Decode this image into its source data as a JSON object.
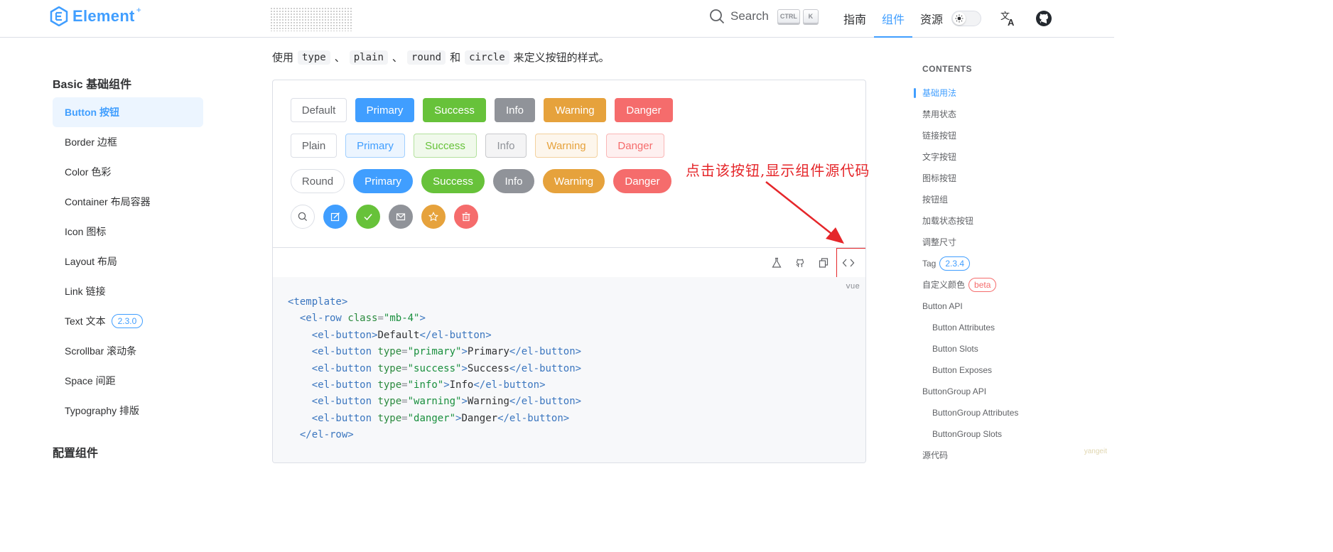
{
  "header": {
    "logo_text": "Element",
    "logo_plus": "+",
    "search_label": "Search",
    "kbd_ctrl": "CTRL",
    "kbd_k": "K",
    "nav": [
      {
        "label": "指南",
        "active": false
      },
      {
        "label": "组件",
        "active": true
      },
      {
        "label": "资源",
        "active": false
      }
    ],
    "accent_color": "#409eff"
  },
  "sidebar": {
    "heading": "Basic 基础组件",
    "items": [
      {
        "label": "Button 按钮",
        "active": true
      },
      {
        "label": "Border 边框"
      },
      {
        "label": "Color 色彩"
      },
      {
        "label": "Container 布局容器"
      },
      {
        "label": "Icon 图标"
      },
      {
        "label": "Layout 布局"
      },
      {
        "label": "Link 链接"
      },
      {
        "label": "Text 文本",
        "badge": "2.3.0"
      },
      {
        "label": "Scrollbar 滚动条"
      },
      {
        "label": "Space 间距"
      },
      {
        "label": "Typography 排版"
      }
    ],
    "heading_2": "配置组件"
  },
  "intro": {
    "prefix": "使用",
    "chip1": "type",
    "sep1": "、",
    "chip2": "plain",
    "sep2": "、",
    "chip3": "round",
    "and": "和",
    "chip4": "circle",
    "suffix": "来定义按钮的样式。"
  },
  "demo": {
    "row_default": [
      "Default",
      "Primary",
      "Success",
      "Info",
      "Warning",
      "Danger"
    ],
    "row_plain": [
      "Plain",
      "Primary",
      "Success",
      "Info",
      "Warning",
      "Danger"
    ],
    "row_round": [
      "Round",
      "Primary",
      "Success",
      "Info",
      "Warning",
      "Danger"
    ],
    "circle_icons": [
      "search-icon",
      "edit-icon",
      "check-icon",
      "message-icon",
      "star-icon",
      "delete-icon"
    ],
    "colors": {
      "primary": "#409eff",
      "success": "#67c23a",
      "info": "#909399",
      "warning": "#e6a23c",
      "danger": "#f56c6c"
    }
  },
  "toolbar": {
    "icons": [
      "playground-icon",
      "github-icon",
      "copy-icon",
      "code-icon"
    ]
  },
  "code": {
    "lang": "vue",
    "lines": [
      "<template>",
      "  <el-row class=\"mb-4\">",
      "    <el-button>Default</el-button>",
      "    <el-button type=\"primary\">Primary</el-button>",
      "    <el-button type=\"success\">Success</el-button>",
      "    <el-button type=\"info\">Info</el-button>",
      "    <el-button type=\"warning\">Warning</el-button>",
      "    <el-button type=\"danger\">Danger</el-button>",
      "  </el-row>"
    ]
  },
  "annotation": {
    "text": "点击该按钮,显示组件源代码",
    "color": "#e5262a"
  },
  "toc": {
    "title": "CONTENTS",
    "items": [
      {
        "label": "基础用法",
        "active": true
      },
      {
        "label": "禁用状态"
      },
      {
        "label": "链接按钮"
      },
      {
        "label": "文字按钮"
      },
      {
        "label": "图标按钮"
      },
      {
        "label": "按钮组"
      },
      {
        "label": "加载状态按钮"
      },
      {
        "label": "调整尺寸"
      },
      {
        "label": "Tag",
        "badge": "2.3.4",
        "badge_color": "#409eff"
      },
      {
        "label": "自定义颜色",
        "badge": "beta",
        "badge_color": "#f56c6c"
      },
      {
        "label": "Button API"
      },
      {
        "label": "Button Attributes",
        "sub": true
      },
      {
        "label": "Button Slots",
        "sub": true
      },
      {
        "label": "Button Exposes",
        "sub": true
      },
      {
        "label": "ButtonGroup API"
      },
      {
        "label": "ButtonGroup Attributes",
        "sub": true
      },
      {
        "label": "ButtonGroup Slots",
        "sub": true
      },
      {
        "label": "源代码"
      }
    ]
  },
  "watermark": "yangeit"
}
